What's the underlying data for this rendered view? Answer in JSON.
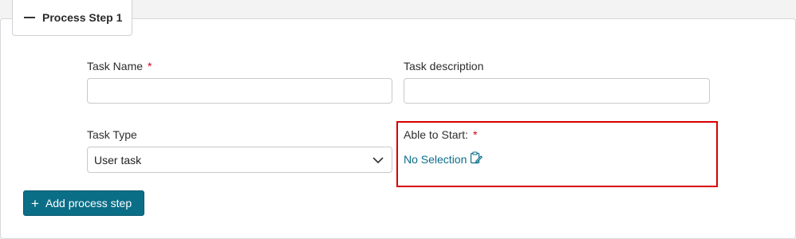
{
  "step": {
    "title": "Process Step 1"
  },
  "fields": {
    "task_name": {
      "label": "Task Name",
      "required_mark": "*",
      "value": ""
    },
    "task_description": {
      "label": "Task description",
      "value": ""
    },
    "task_type": {
      "label": "Task Type",
      "selected": "User task"
    },
    "able_to_start": {
      "label": "Able to Start:",
      "required_mark": "*",
      "value": "No Selection"
    }
  },
  "actions": {
    "add_step_label": "Add process step"
  },
  "icons": {
    "collapse": "minus-icon",
    "dropdown": "chevron-down-icon",
    "edit": "edit-clipboard-icon",
    "add": "plus-icon"
  },
  "colors": {
    "primary": "#0b6e87",
    "link": "#0a6e8a",
    "required": "#d0021b",
    "highlight": "#d80000"
  }
}
